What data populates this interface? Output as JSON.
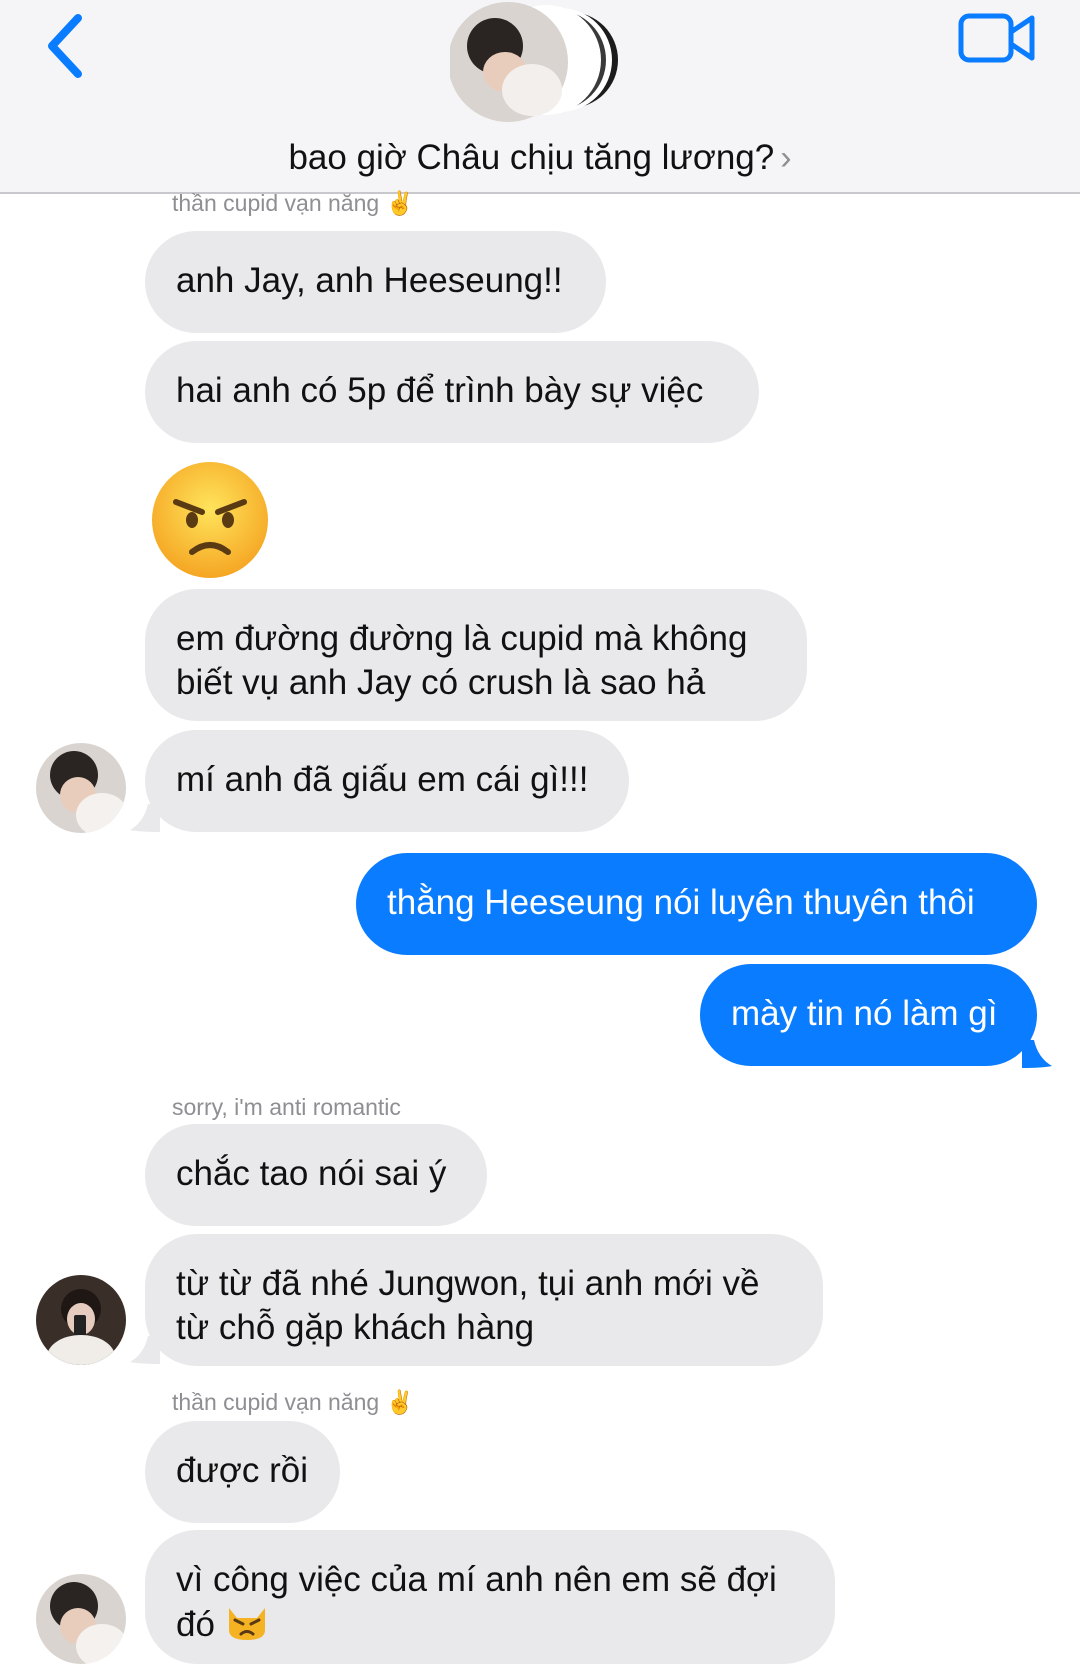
{
  "header": {
    "title": "bao giờ Châu chịu tăng lương?",
    "chevron": "›",
    "back_icon": "chevron-left-icon",
    "video_icon": "video-camera-icon"
  },
  "messages": {
    "sender_1": "thần cupid vạn năng ✌️",
    "m1": "anh Jay, anh Heeseung!!",
    "m2": "hai anh có 5p để trình bày sự việc",
    "m3_emoji": "angry-face-emoji",
    "m4_line1": "em đường đường là cupid mà không",
    "m4_line2": "biết vụ anh Jay có crush là sao hả",
    "m5": "mí anh đã giấu em cái gì!!!",
    "out1": "thằng Heeseung nói luyên thuyên thôi",
    "out2": "mày tin nó làm gì",
    "sender_2": "sorry, i'm anti romantic",
    "m6": "chắc tao nói sai ý",
    "m7_line1": "từ từ đã nhé Jungwon, tụi anh mới về",
    "m7_line2": "từ chỗ gặp khách hàng",
    "sender_3": "thần cupid vạn năng ✌️",
    "m8": "được rồi",
    "m9_line1": "vì công việc của mí anh nên em sẽ đợi",
    "m9_line2": "đó",
    "m9_emoji": "pouting-cat-emoji"
  },
  "colors": {
    "accent": "#0a7cff",
    "incoming_bubble": "#e9e9eb",
    "header_bg": "#f5f5f7"
  }
}
